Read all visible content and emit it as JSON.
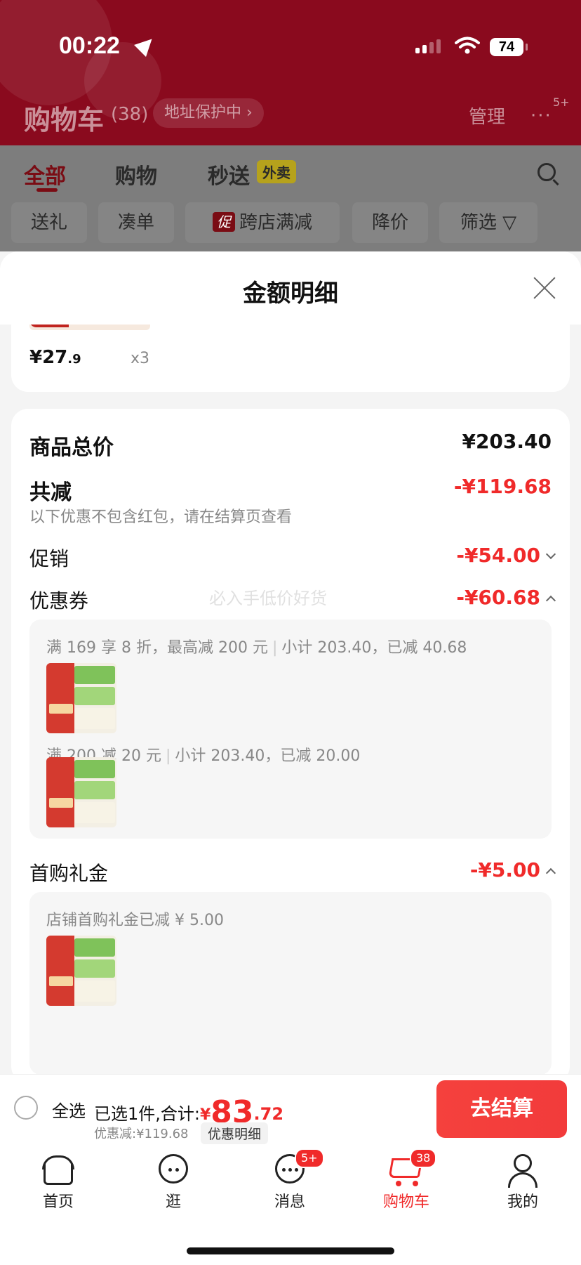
{
  "status_bar": {
    "time": "00:22",
    "battery": "74"
  },
  "nav": {
    "title": "购物车",
    "count": "(38)",
    "address_protect": "地址保护中 ›",
    "manage": "管理",
    "more": "···",
    "more_badge": "5+"
  },
  "tabs": [
    {
      "label": "全部"
    },
    {
      "label": "购物"
    },
    {
      "label": "秒送"
    }
  ],
  "tag_waimai": "外卖",
  "filters": [
    {
      "label": "送礼"
    },
    {
      "label": "凑单"
    },
    {
      "label": "跨店满减",
      "tag": "促"
    },
    {
      "label": "降价"
    },
    {
      "label": "筛选 ▽"
    }
  ],
  "sheet": {
    "title": "金额明细",
    "product_price": {
      "currency": "¥",
      "int": "27",
      "dec": ".9",
      "qty": "x3"
    },
    "total": {
      "label": "商品总价",
      "value": "¥203.40"
    },
    "reduce": {
      "label": "共减",
      "value": "-¥119.68",
      "note": "以下优惠不包含红包，请在结算页查看"
    },
    "promo": {
      "label": "促销",
      "value": "-¥54.00"
    },
    "coupon": {
      "label": "优惠券",
      "value": "-¥60.68",
      "watermark": "必入手低价好货",
      "lines": [
        {
          "cond": "满 169 享 8 折，最高减 200 元",
          "detail": "小计 203.40，已减 40.68"
        },
        {
          "cond": "满 200 减 20 元",
          "detail": "小计 203.40，已减 20.00"
        }
      ]
    },
    "first_gift": {
      "label": "首购礼金",
      "value": "-¥5.00",
      "note": "店铺首购礼金已减 ¥ 5.00"
    }
  },
  "checkout": {
    "select_all": "全选",
    "selected_text": "已选1件,合计:",
    "total_currency": "¥",
    "total_int": "83",
    "total_dec": ".72",
    "discount": "优惠减:¥119.68",
    "detail_label": "优惠明细",
    "button": "去结算"
  },
  "tabbar": [
    {
      "label": "首页"
    },
    {
      "label": "逛"
    },
    {
      "label": "消息",
      "badge": "5+"
    },
    {
      "label": "购物车",
      "badge": "38"
    },
    {
      "label": "我的"
    }
  ],
  "colors": {
    "brand_red": "#f02a2a",
    "header_red": "#8a0a1e"
  }
}
